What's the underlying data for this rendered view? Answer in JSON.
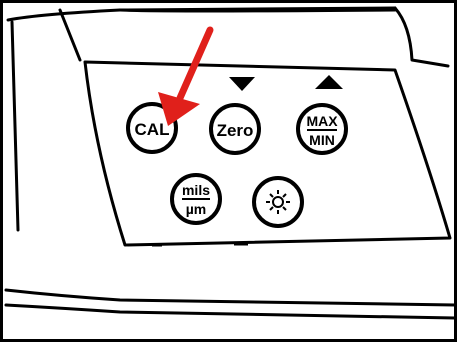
{
  "keypad": {
    "cal_label": "CAL",
    "zero_label": "Zero",
    "max_label": "MAX",
    "min_label": "MIN",
    "mils_label": "mils",
    "um_label": "µm",
    "light_icon": "sun-icon",
    "zero_arrow_icon": "triangle-down-icon",
    "max_arrow_icon": "triangle-up-icon"
  },
  "pointer": {
    "icon": "red-arrow-icon",
    "target": "CAL",
    "color": "#e0201b"
  }
}
